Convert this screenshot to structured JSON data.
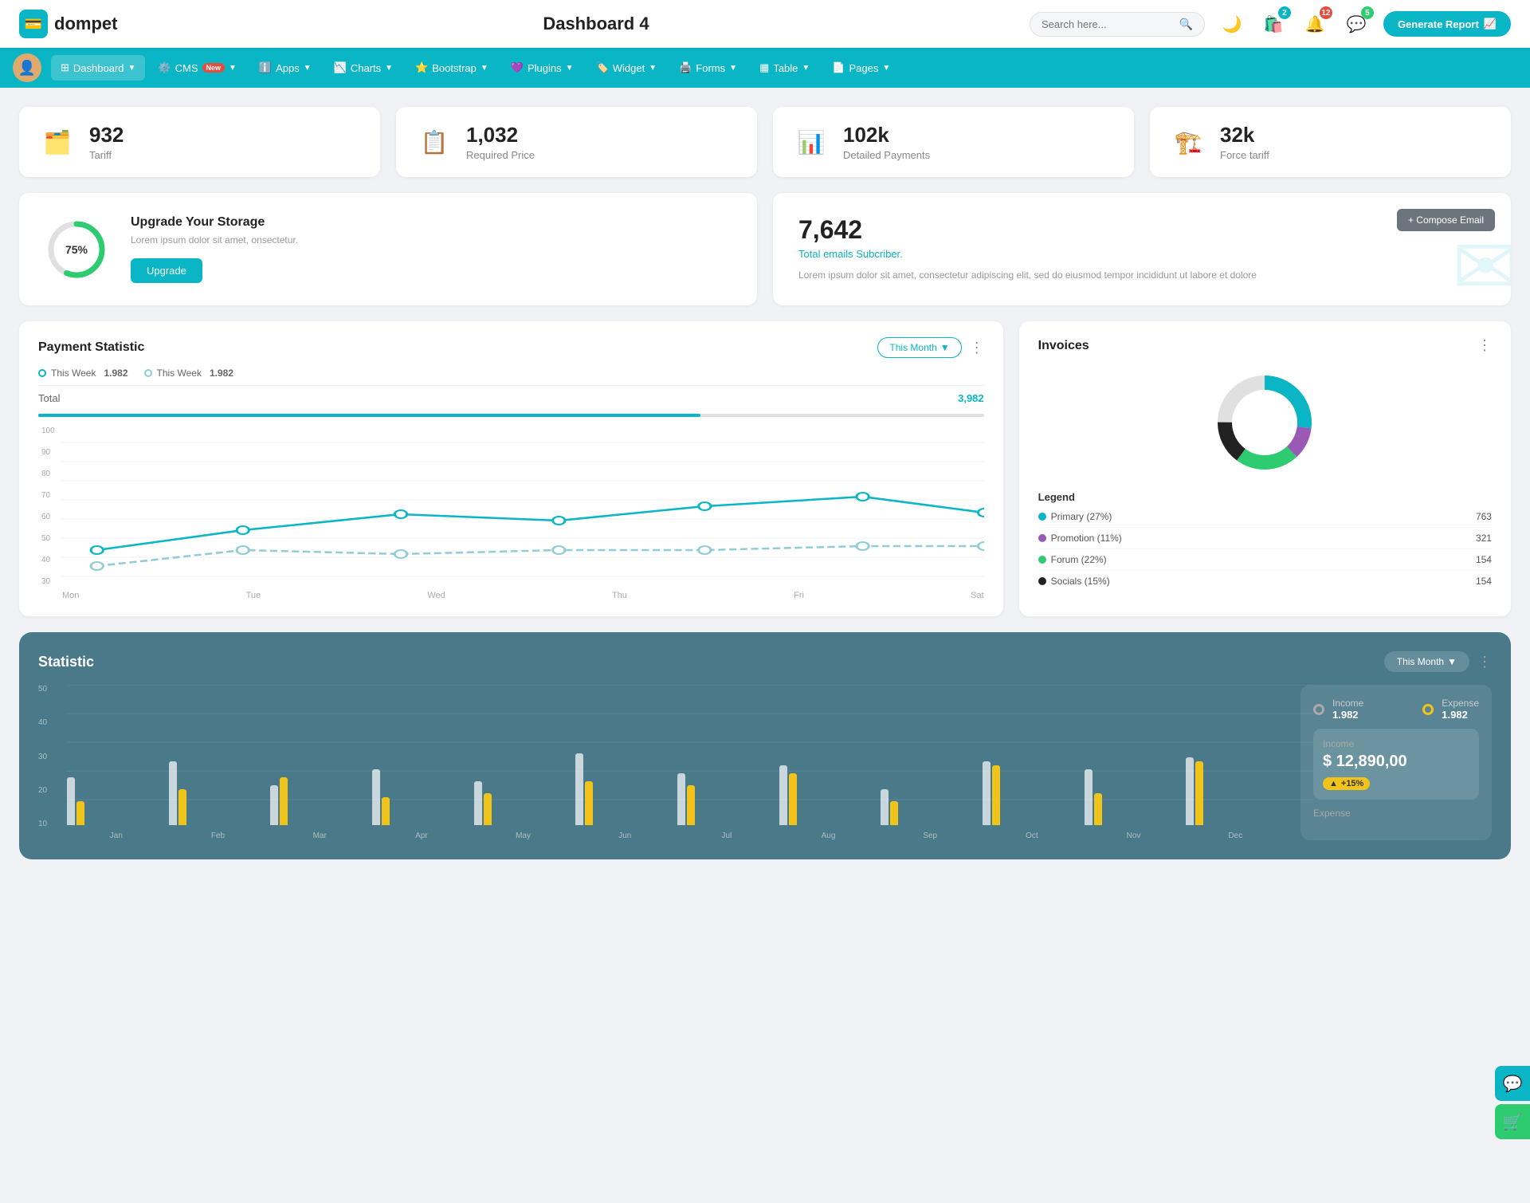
{
  "header": {
    "logo_text": "dompet",
    "page_title": "Dashboard 4",
    "search_placeholder": "Search here...",
    "generate_btn": "Generate Report",
    "badge_cart": "2",
    "badge_bell": "12",
    "badge_chat": "5"
  },
  "navbar": {
    "items": [
      {
        "id": "dashboard",
        "label": "Dashboard",
        "active": true,
        "has_arrow": true
      },
      {
        "id": "cms",
        "label": "CMS",
        "active": false,
        "has_badge": true,
        "badge_text": "New",
        "has_arrow": true
      },
      {
        "id": "apps",
        "label": "Apps",
        "active": false,
        "has_arrow": true
      },
      {
        "id": "charts",
        "label": "Charts",
        "active": false,
        "has_arrow": true
      },
      {
        "id": "bootstrap",
        "label": "Bootstrap",
        "active": false,
        "has_arrow": true
      },
      {
        "id": "plugins",
        "label": "Plugins",
        "active": false,
        "has_arrow": true
      },
      {
        "id": "widget",
        "label": "Widget",
        "active": false,
        "has_arrow": true
      },
      {
        "id": "forms",
        "label": "Forms",
        "active": false,
        "has_arrow": true
      },
      {
        "id": "table",
        "label": "Table",
        "active": false,
        "has_arrow": true
      },
      {
        "id": "pages",
        "label": "Pages",
        "active": false,
        "has_arrow": true
      }
    ]
  },
  "stat_cards": [
    {
      "id": "tariff",
      "value": "932",
      "label": "Tariff",
      "icon": "🗂️",
      "icon_color": "#0ab5c5"
    },
    {
      "id": "required_price",
      "value": "1,032",
      "label": "Required Price",
      "icon": "📋",
      "icon_color": "#e74c3c"
    },
    {
      "id": "detailed_payments",
      "value": "102k",
      "label": "Detailed Payments",
      "icon": "📊",
      "icon_color": "#9b59b6"
    },
    {
      "id": "force_tariff",
      "value": "32k",
      "label": "Force tariff",
      "icon": "🏗️",
      "icon_color": "#e91e96"
    }
  ],
  "storage": {
    "percent": 75,
    "title": "Upgrade Your Storage",
    "description": "Lorem ipsum dolor sit amet, onsectetur.",
    "btn_label": "Upgrade"
  },
  "email": {
    "count": "7,642",
    "subtitle": "Total emails Subcriber.",
    "description": "Lorem ipsum dolor sit amet, consectetur adipiscing elit, sed do eiusmod tempor incididunt ut labore et dolore",
    "compose_btn": "+ Compose Email"
  },
  "payment_statistic": {
    "title": "Payment Statistic",
    "filter_btn": "This Month",
    "legend": [
      {
        "label": "This Week",
        "value": "1.982",
        "color": "#0ab5c5"
      },
      {
        "label": "This Week",
        "value": "1.982",
        "color": "#90cdd4"
      }
    ],
    "total_label": "Total",
    "total_value": "3,982",
    "chart_y": [
      "100",
      "90",
      "80",
      "70",
      "60",
      "50",
      "40",
      "30"
    ],
    "chart_x": [
      "Mon",
      "Tue",
      "Wed",
      "Thu",
      "Fri",
      "Sat"
    ],
    "line1_points": "30,185 100,145 200,125 300,115 400,135 500,110 600,95 700,110",
    "line2_points": "30,155 100,160 200,150 300,155 400,150 500,155 600,150 700,150"
  },
  "invoices": {
    "title": "Invoices",
    "legend": [
      {
        "label": "Primary (27%)",
        "value": "763",
        "color": "#0ab5c5"
      },
      {
        "label": "Promotion (11%)",
        "value": "321",
        "color": "#9b59b6"
      },
      {
        "label": "Forum (22%)",
        "value": "154",
        "color": "#2ecc71"
      },
      {
        "label": "Socials (15%)",
        "value": "154",
        "color": "#222"
      }
    ],
    "donut_segments": [
      {
        "color": "#0ab5c5",
        "percent": 27
      },
      {
        "color": "#9b59b6",
        "percent": 11
      },
      {
        "color": "#2ecc71",
        "percent": 22
      },
      {
        "color": "#222",
        "percent": 15
      },
      {
        "color": "#e0e0e0",
        "percent": 25
      }
    ]
  },
  "statistic": {
    "title": "Statistic",
    "filter_btn": "This Month",
    "income_label": "Income",
    "income_value": "1.982",
    "expense_label": "Expense",
    "expense_value": "1.982",
    "income_detail_label": "Income",
    "income_amount": "$ 12,890,00",
    "income_change": "+15%",
    "bar_y_labels": [
      "50",
      "40",
      "30",
      "20",
      "10"
    ],
    "bar_x_labels": [
      "Jan",
      "Feb",
      "Mar",
      "Apr",
      "May",
      "Jun",
      "Jul",
      "Aug",
      "Sep",
      "Oct",
      "Nov",
      "Dec"
    ],
    "bars": [
      {
        "white": 60,
        "yellow": 30
      },
      {
        "white": 80,
        "yellow": 45
      },
      {
        "white": 50,
        "yellow": 60
      },
      {
        "white": 70,
        "yellow": 35
      },
      {
        "white": 55,
        "yellow": 40
      },
      {
        "white": 90,
        "yellow": 55
      },
      {
        "white": 65,
        "yellow": 50
      },
      {
        "white": 75,
        "yellow": 65
      },
      {
        "white": 45,
        "yellow": 30
      },
      {
        "white": 80,
        "yellow": 75
      },
      {
        "white": 70,
        "yellow": 40
      },
      {
        "white": 85,
        "yellow": 80
      }
    ]
  }
}
